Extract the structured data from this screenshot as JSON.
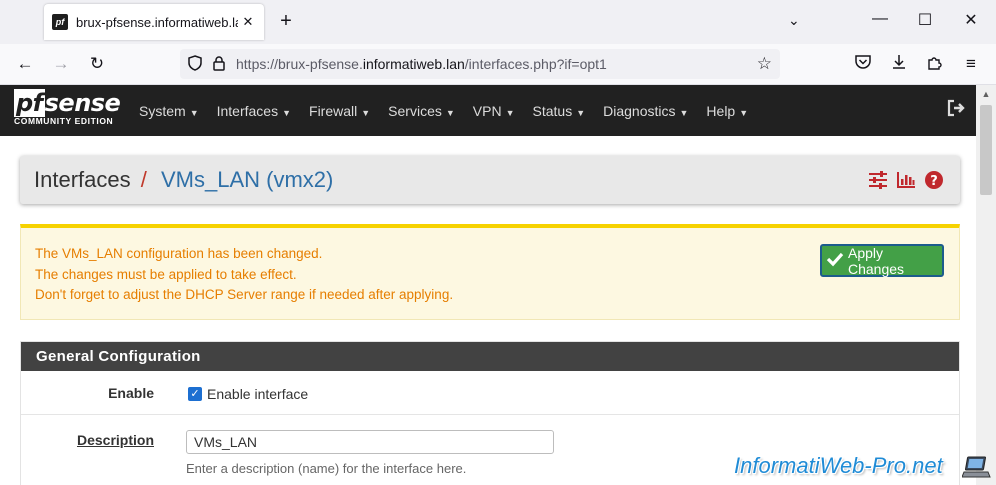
{
  "browser": {
    "tab_title": "brux-pfsense.informatiweb.lan",
    "url_prefix": "https://brux-pfsense.",
    "url_host": "informatiweb.lan",
    "url_suffix": "/interfaces.php?if=opt1"
  },
  "pfsense": {
    "logo_text": "sense",
    "logo_pf": "pf",
    "logo_edition": "COMMUNITY EDITION",
    "menu": [
      {
        "label": "System"
      },
      {
        "label": "Interfaces"
      },
      {
        "label": "Firewall"
      },
      {
        "label": "Services"
      },
      {
        "label": "VPN"
      },
      {
        "label": "Status"
      },
      {
        "label": "Diagnostics"
      },
      {
        "label": "Help"
      }
    ]
  },
  "breadcrumb": {
    "root": "Interfaces",
    "separator": "/",
    "current": "VMs_LAN (vmx2)"
  },
  "alert": {
    "lines": [
      "The VMs_LAN configuration has been changed.",
      "The changes must be applied to take effect.",
      "Don't forget to adjust the DHCP Server range if needed after applying."
    ],
    "apply_label": "Apply Changes"
  },
  "general": {
    "title": "General Configuration",
    "enable_label": "Enable",
    "enable_checkbox_label": "Enable interface",
    "enable_checked": true,
    "description_label": "Description",
    "description_value": "VMs_LAN",
    "description_help": "Enter a description (name) for the interface here."
  },
  "watermark": "InformatiWeb-Pro.net",
  "colors": {
    "navbar_bg": "#212121",
    "breadcrumb_link": "#2e6fa7",
    "breadcrumb_sep": "#c0392b",
    "alert_text": "#e67e00",
    "alert_bg": "#fdf8e1",
    "apply_btn": "#43a047",
    "icon_red": "#c0282d"
  }
}
